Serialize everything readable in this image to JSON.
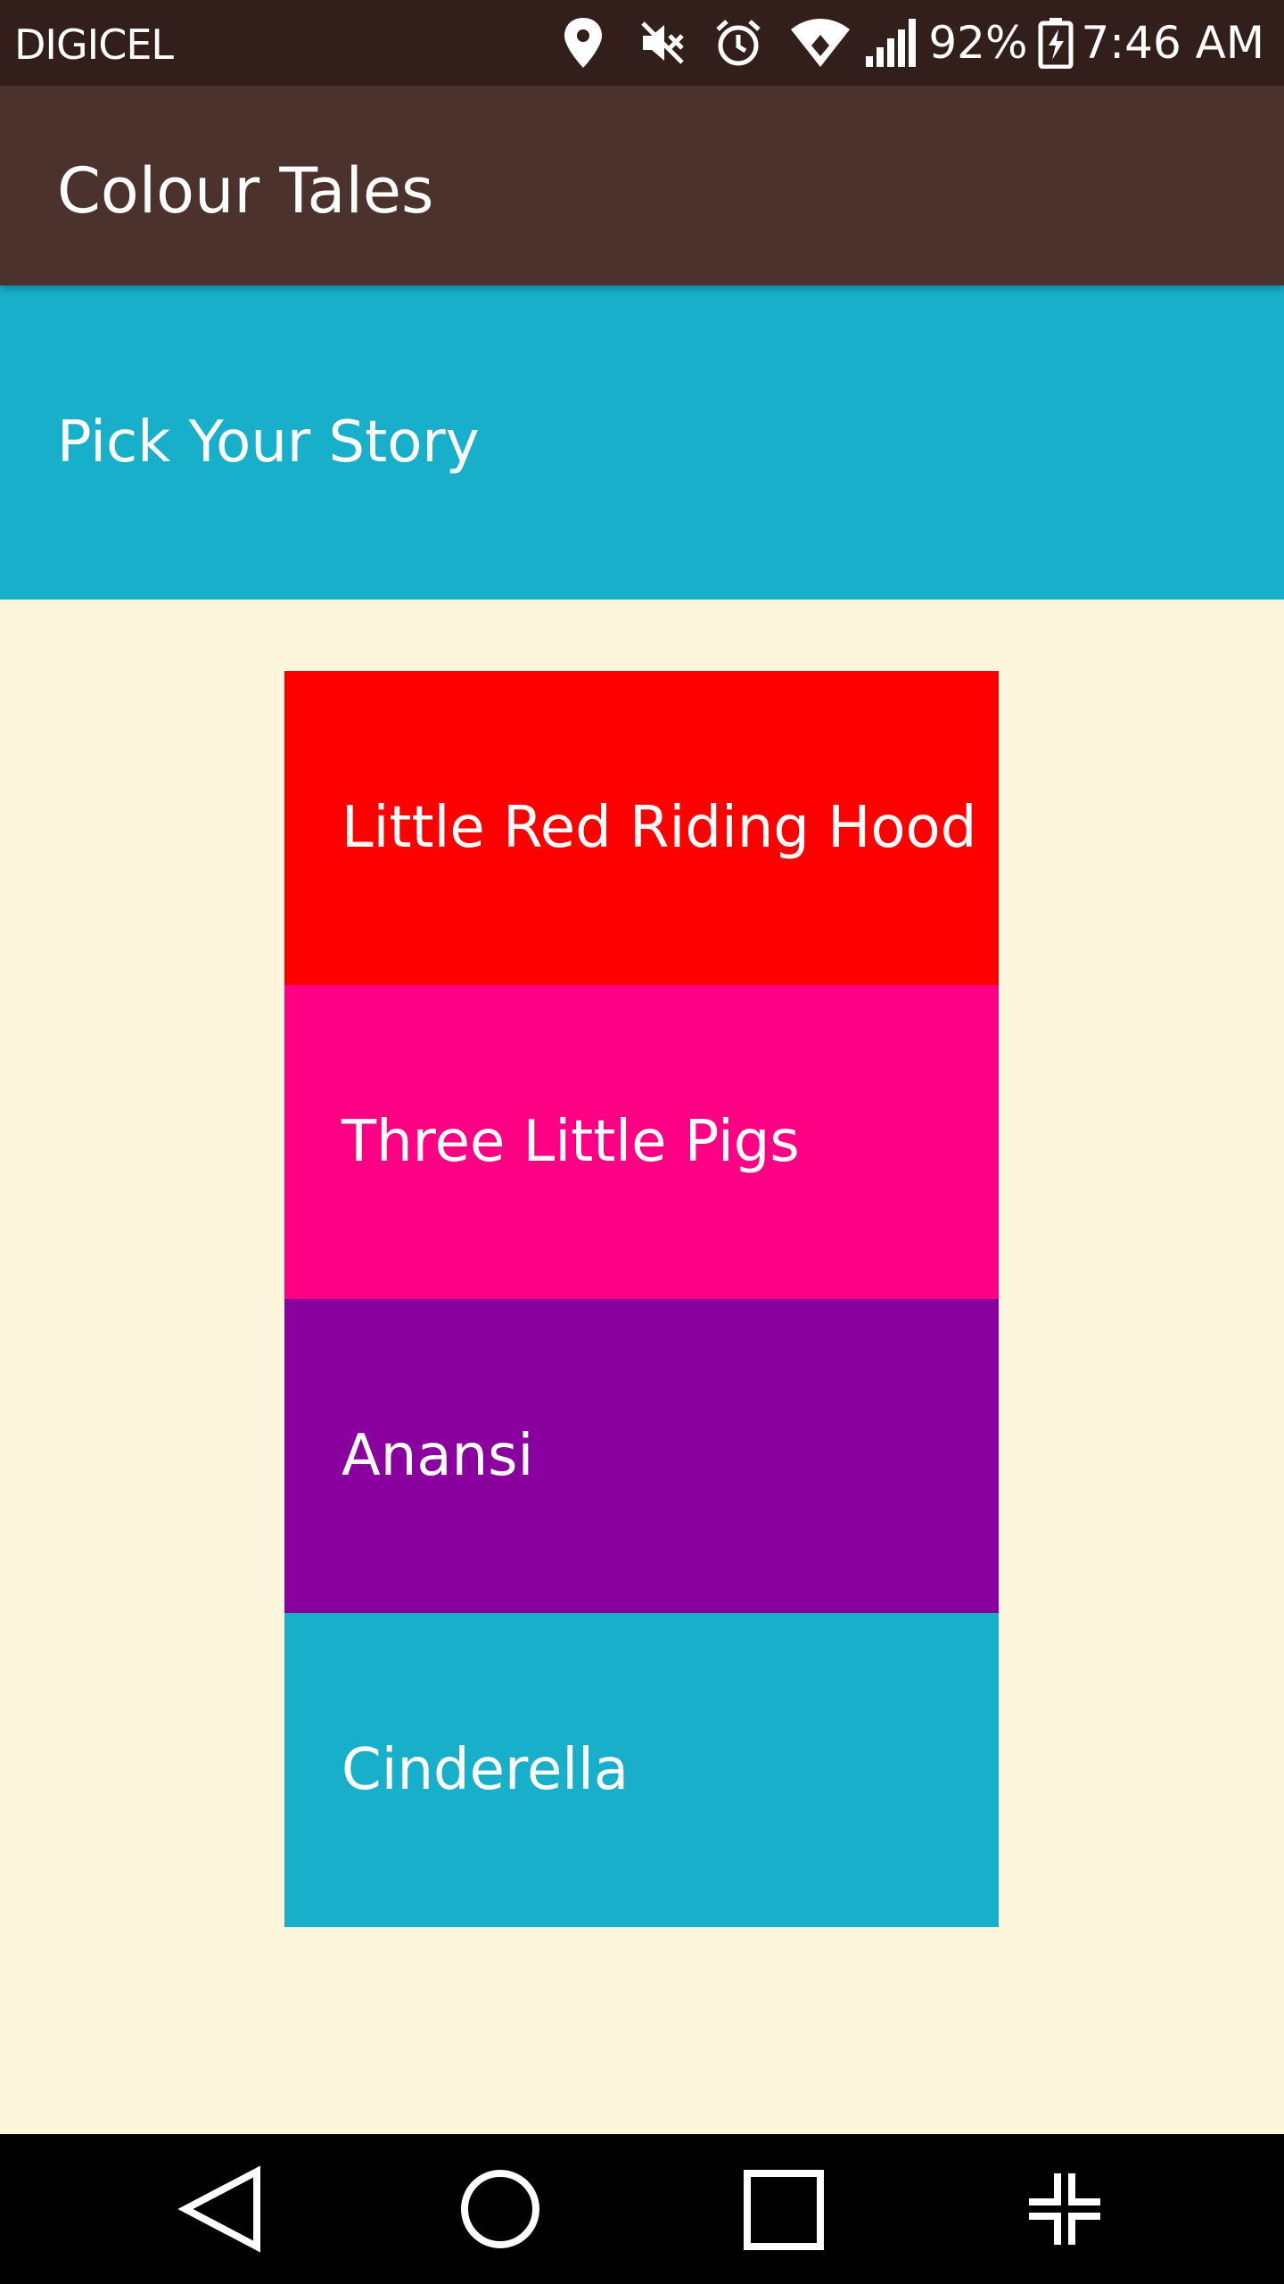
{
  "status_bar": {
    "carrier": "DIGICEL",
    "battery_percent": "92%",
    "time": "7:46 AM",
    "icons": [
      "location-icon",
      "mute-icon",
      "alarm-icon",
      "wifi-icon",
      "signal-icon",
      "battery-charging-icon"
    ]
  },
  "app_bar": {
    "title": "Colour Tales",
    "color": "#4c322c"
  },
  "header": {
    "text": "Pick Your Story",
    "color": "#18afcb"
  },
  "stories": [
    {
      "label": "Little Red Riding Hood",
      "color": "#ff0000"
    },
    {
      "label": "Three Little Pigs",
      "color": "#fe0084"
    },
    {
      "label": "Anansi",
      "color": "#89009f"
    },
    {
      "label": "Cinderella",
      "color": "#18afcb"
    }
  ],
  "nav_bar": {
    "buttons": [
      "back-icon",
      "home-icon",
      "recents-icon",
      "exit-fullscreen-icon"
    ]
  }
}
